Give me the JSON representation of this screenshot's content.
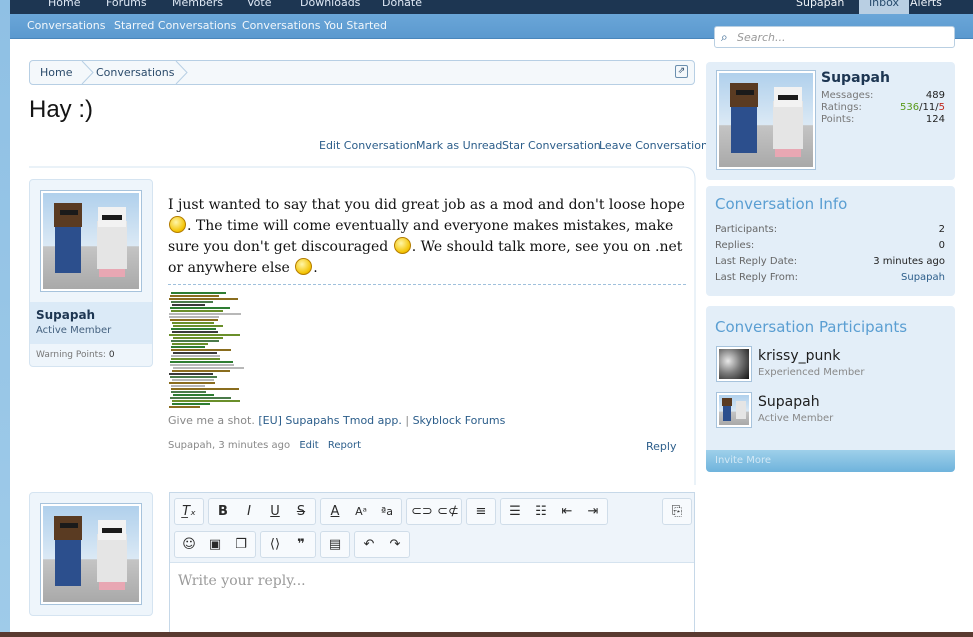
{
  "nav": {
    "tabs": [
      "Home",
      "Forums",
      "Members",
      "Vote",
      "Downloads",
      "Donate"
    ],
    "user": "Supapah",
    "inbox": "Inbox",
    "alerts": "Alerts"
  },
  "subnav": {
    "items": [
      "Conversations",
      "Starred Conversations",
      "Conversations You Started"
    ]
  },
  "breadcrumb": {
    "items": [
      "Home",
      "Conversations"
    ]
  },
  "page": {
    "title": "Hay :)"
  },
  "actions": {
    "edit": "Edit Conversation",
    "unread": "Mark as Unread",
    "star": "Star Conversation",
    "leave": "Leave Conversation"
  },
  "message": {
    "author": "Supapah",
    "author_title": "Active Member",
    "warning_label": "Warning Points:",
    "warning_value": "0",
    "text_1": "I just wanted to say that you did great job as a mod and don't loose hope",
    "text_2": ". The time will come eventually and everyone makes mistakes, make sure you don't get discouraged",
    "text_3": ". We should talk more, see you on .net or anywhere else",
    "text_4": ".",
    "sig_text": "Give me a shot.",
    "sig_link_1": "[EU] Supapahs Tmod app.",
    "sig_sep": "|",
    "sig_link_2": "Skyblock Forums",
    "meta": "Supapah, 3 minutes ago",
    "edit": "Edit",
    "report": "Report",
    "reply": "Reply"
  },
  "editor": {
    "placeholder": "Write your reply..."
  },
  "sidebar": {
    "search_placeholder": "Search...",
    "user": {
      "name": "Supapah",
      "messages_label": "Messages:",
      "messages": "489",
      "ratings_label": "Ratings:",
      "ratings_pos": "536",
      "ratings_neutral": "11",
      "ratings_neg": "5",
      "ratings_sep": "/",
      "points_label": "Points:",
      "points": "124"
    },
    "info": {
      "heading": "Conversation Info",
      "participants_label": "Participants:",
      "participants": "2",
      "replies_label": "Replies:",
      "replies": "0",
      "last_date_label": "Last Reply Date:",
      "last_date": "3 minutes ago",
      "last_from_label": "Last Reply From:",
      "last_from": "Supapah"
    },
    "participants": {
      "heading": "Conversation Participants",
      "list": [
        {
          "name": "krissy_punk",
          "title": "Experienced Member"
        },
        {
          "name": "Supapah",
          "title": "Active Member"
        }
      ],
      "invite": "Invite More"
    }
  },
  "colors": {
    "nav_dark": "#1d3652",
    "subnav": "#5b99cf",
    "link": "#2b5d8a",
    "sidebar_heading": "#5a9ed2",
    "rating_pos": "#5a9a1a",
    "rating_neg": "#c0281e"
  }
}
